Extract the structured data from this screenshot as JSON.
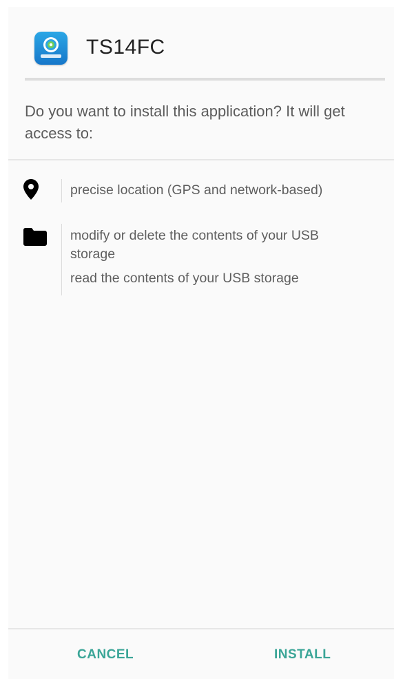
{
  "app": {
    "name": "TS14FC",
    "icon": "app-launcher-icon"
  },
  "prompt": {
    "question": "Do you want to install this application? It will get access to:"
  },
  "permissions": [
    {
      "icon": "location-pin-icon",
      "lines": [
        "precise location (GPS and network-based)"
      ]
    },
    {
      "icon": "folder-icon",
      "lines": [
        "modify or delete the contents of your USB",
        "storage",
        "read the contents of your USB storage"
      ]
    }
  ],
  "buttons": {
    "cancel_label": "CANCEL",
    "install_label": "INSTALL"
  },
  "colors": {
    "accent": "#3aa597",
    "text_secondary": "#5e5e5e",
    "title": "#212121"
  }
}
